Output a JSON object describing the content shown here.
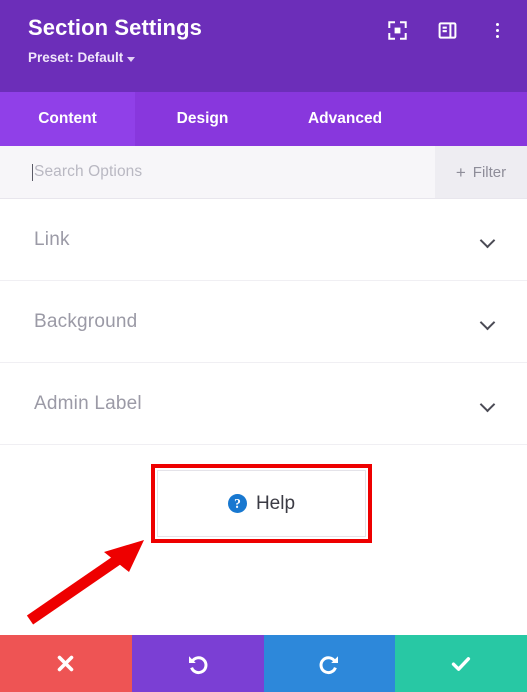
{
  "header": {
    "title": "Section Settings",
    "preset_label": "Preset: Default",
    "icons": [
      {
        "name": "fullscreen-icon",
        "label": "Fullscreen"
      },
      {
        "name": "layout-panel-icon",
        "label": "Panel Layout"
      },
      {
        "name": "more-options-icon",
        "label": "More Options"
      }
    ],
    "background_color": "#6c2eb9"
  },
  "tabs": {
    "active": "Content",
    "items": [
      {
        "label": "Content"
      },
      {
        "label": "Design"
      },
      {
        "label": "Advanced"
      }
    ],
    "active_color": "#9040e8",
    "inactive_color": "#8837dd"
  },
  "search": {
    "placeholder": "Search Options",
    "value": "",
    "filter_label": "Filter",
    "filter_plus": "+"
  },
  "options": {
    "rows": [
      {
        "label": "Link",
        "expanded": false
      },
      {
        "label": "Background",
        "expanded": false
      },
      {
        "label": "Admin Label",
        "expanded": false
      }
    ]
  },
  "help": {
    "label": "Help",
    "icon_glyph": "?",
    "icon_color": "#1878d0",
    "highlight_color": "#ee0000"
  },
  "annotation": {
    "arrow_color": "#ee0000",
    "points_to": "Help"
  },
  "bottom_bar": {
    "buttons": [
      {
        "name": "cancel-button",
        "glyph": "✖",
        "color": "#ee5454"
      },
      {
        "name": "undo-button",
        "glyph": "undo",
        "color": "#7b3fd4"
      },
      {
        "name": "redo-button",
        "glyph": "redo",
        "color": "#2d88da"
      },
      {
        "name": "save-button",
        "glyph": "✔",
        "color": "#28c8a4"
      }
    ]
  }
}
